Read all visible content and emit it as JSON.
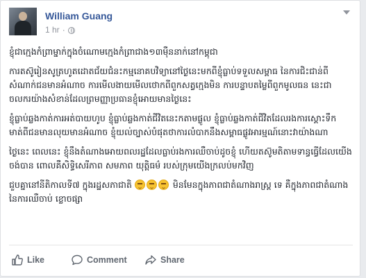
{
  "post": {
    "author": "William Guang",
    "time": "1 hr",
    "separator": "·",
    "paragraphs": [
      "ខ្ញុំជាក្មេងកំព្រាម្នាក់ក្នុងចំណោមក្មេងកំព្រាជាង១៣ម៉ឺននាក់នៅកម្ពុជា",
      "ការតស៊ូរៀនសូត្រហូតដោតជ័យជំនះកម្មនោគបវិទ្យានៅថ្ងៃនេះមកពីខ្ញុំធ្លាប់ទទួលសម្ពាធ នៃការជិះជាន់ពីសំណាក់ជនមានអំណាច ការមើលងាយមើលថោកពីពួកសត្វក្មេងមិន ការបន្ទាបតម្លៃពីពួកមូលធន នេះជាចលករយ៉ាងសំខាន់ដែលព្រមញ្ញាប្រធានខ្ញុំអោយមានថ្ងៃនេះ",
      "ខ្ញុំធ្លាប់ឆ្លងកាត់ការអត់បាយហូប ខ្ញុំធ្លាប់ឆ្លងកាត់ជីវិតនេះកតាមផ្លូល ខ្ញុំធ្លាប់ឆ្លងកាត់ជីវិតដែលរងការស្តោះទឹកមាត់ពីជនមានលុយមានអំណាច ខ្ញុំយល់ច្បាស់បំផុតថាការលំបាកនឹងសម្ពាធផ្លូវអារម្មណ៍នោះវាយ៉ាងណា",
      "ថ្ងៃនេះ ពេលនេះ ខ្ញុំនឹងតំណាងអោយពលរដ្ឋដែលធ្លាប់រងការឈឺចាប់ដូចខ្ញុំ ហើយតស៊ូមតិតាមទាន្ធធ្វើដែលយើងចង់បាន ពោលគឺសិទ្ធិសេរីភាព សមភាព យុត្តិធម៌ របស់ក្រុមយើងក្រលប់មកវិញ",
      "ជួបគ្នានៅនីតិកាលទី៧ ក្នុងរដ្ឋសភាជាតិ",
      "មិនមែនក្នុងភាពជាតំណាងរាស្រ្ត ទេ គឺក្នុងភាពជាតំណាងនៃការឈឺចាប់ ខ្លោចផ្សា"
    ]
  },
  "actions": {
    "like": "Like",
    "comment": "Comment",
    "share": "Share"
  },
  "icons": {
    "avatar": "profile-photo",
    "privacy": "globe-icon",
    "menu": "chevron-down-icon",
    "like": "thumbs-up-icon",
    "comment": "speech-bubble-icon",
    "share": "share-arrow-icon",
    "emoji": "smiling-face-icon"
  },
  "colors": {
    "author": "#365899",
    "meta": "#90949c",
    "text": "#1d2129",
    "action": "#606770",
    "background": "#e9ebee"
  }
}
